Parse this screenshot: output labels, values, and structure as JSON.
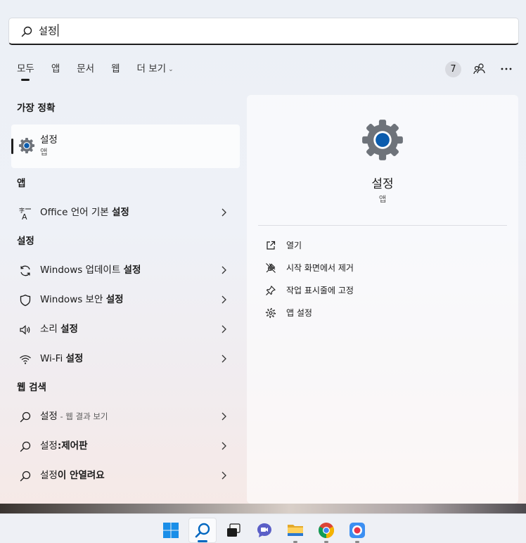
{
  "search": {
    "query": "설정"
  },
  "filters": [
    {
      "label": "모두",
      "active": true
    },
    {
      "label": "앱"
    },
    {
      "label": "문서"
    },
    {
      "label": "웹"
    },
    {
      "label": "더 보기"
    }
  ],
  "header": {
    "count": "7"
  },
  "sections": {
    "best_match": "가장 정확",
    "apps": "앱",
    "settings": "설정",
    "web": "웹 검색"
  },
  "best_match": {
    "name": "설정",
    "kind": "앱"
  },
  "apps_results": [
    {
      "pre": "Office 언어 기본 ",
      "bold": "설정"
    }
  ],
  "settings_results": [
    {
      "pre": "Windows 업데이트 ",
      "bold": "설정"
    },
    {
      "pre": "Windows 보안 ",
      "bold": "설정"
    },
    {
      "pre": "소리 ",
      "bold": "설정"
    },
    {
      "pre": "Wi-Fi ",
      "bold": "설정"
    }
  ],
  "web_results": [
    {
      "pre": "설정",
      "sub": " - 웹 결과 보기",
      "bold": ""
    },
    {
      "pre": "설정",
      "bold": ":제어판"
    },
    {
      "pre": "설정",
      "bold": "이 안열려요"
    }
  ],
  "detail": {
    "name": "설정",
    "kind": "앱",
    "actions": [
      "열기",
      "시작 화면에서 제거",
      "작업 표시줄에 고정",
      "앱 설정"
    ]
  },
  "colors": {
    "accent": "#0067c0",
    "gear_gray": "#6e737a",
    "gear_blue": "#0b5cad"
  },
  "taskbar": [
    "start-icon",
    "search-icon",
    "task-view-icon",
    "teams-chat-icon",
    "file-explorer-icon",
    "chrome-icon",
    "recorder-icon"
  ]
}
